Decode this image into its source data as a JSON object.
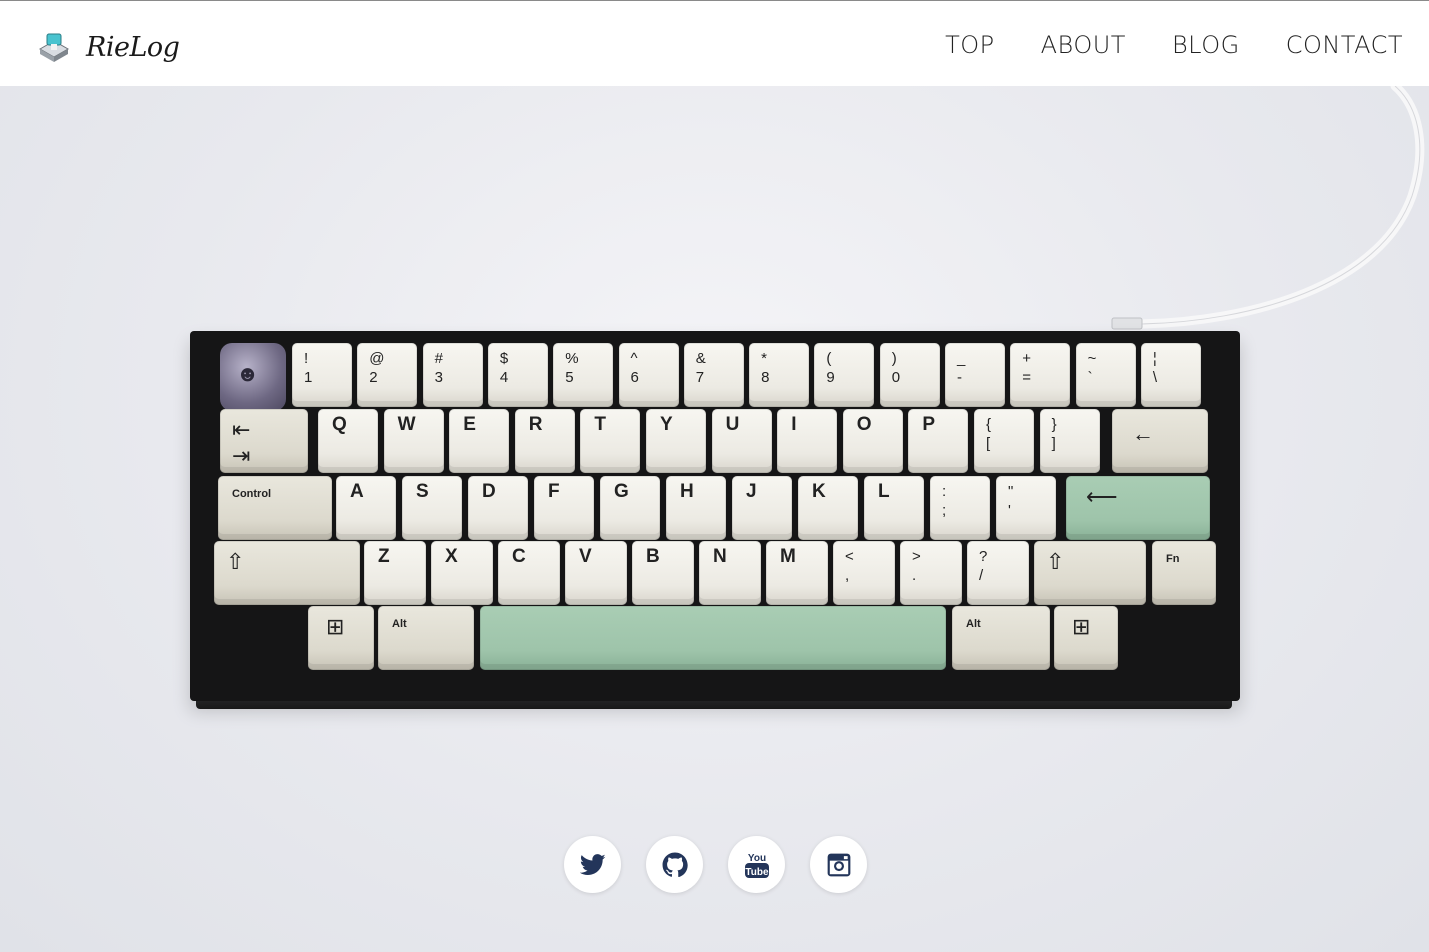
{
  "site": {
    "brand": "RieLog",
    "logo_icon": "keyswitch-icon"
  },
  "nav": [
    {
      "label": "TOP"
    },
    {
      "label": "ABOUT"
    },
    {
      "label": "BLOG"
    },
    {
      "label": "CONTACT"
    }
  ],
  "keyboard": {
    "row1": [
      {
        "top": "!",
        "bot": "1"
      },
      {
        "top": "@",
        "bot": "2"
      },
      {
        "top": "#",
        "bot": "3"
      },
      {
        "top": "$",
        "bot": "4"
      },
      {
        "top": "%",
        "bot": "5"
      },
      {
        "top": "^",
        "bot": "6"
      },
      {
        "top": "&",
        "bot": "7"
      },
      {
        "top": "*",
        "bot": "8"
      },
      {
        "top": "(",
        "bot": "9"
      },
      {
        "top": ")",
        "bot": "0"
      },
      {
        "top": "_",
        "bot": "-"
      },
      {
        "top": "+",
        "bot": "="
      },
      {
        "top": "~",
        "bot": "`"
      },
      {
        "top": "¦",
        "bot": "\\"
      }
    ],
    "row2": [
      "Q",
      "W",
      "E",
      "R",
      "T",
      "Y",
      "U",
      "I",
      "O",
      "P"
    ],
    "row2_brackets": [
      {
        "top": "{",
        "bot": "["
      },
      {
        "top": "}",
        "bot": "]"
      }
    ],
    "row3_mod": "Control",
    "row3": [
      "A",
      "S",
      "D",
      "F",
      "G",
      "H",
      "J",
      "K",
      "L"
    ],
    "row3_punct": [
      {
        "top": ":",
        "bot": ";"
      },
      {
        "top": "\"",
        "bot": "'"
      }
    ],
    "row4": [
      "Z",
      "X",
      "C",
      "V",
      "B",
      "N",
      "M"
    ],
    "row4_punct": [
      {
        "top": "<",
        "bot": ","
      },
      {
        "top": ">",
        "bot": "."
      },
      {
        "top": "?",
        "bot": "/"
      }
    ],
    "fn": "Fn",
    "alt": "Alt"
  },
  "social": [
    {
      "name": "twitter-icon"
    },
    {
      "name": "github-icon"
    },
    {
      "name": "youtube-icon",
      "text_top": "You",
      "text_bottom": "Tube"
    },
    {
      "name": "instagram-icon"
    }
  ],
  "colors": {
    "accent_mint": "#9ec4aa",
    "icon_navy": "#23355a"
  }
}
